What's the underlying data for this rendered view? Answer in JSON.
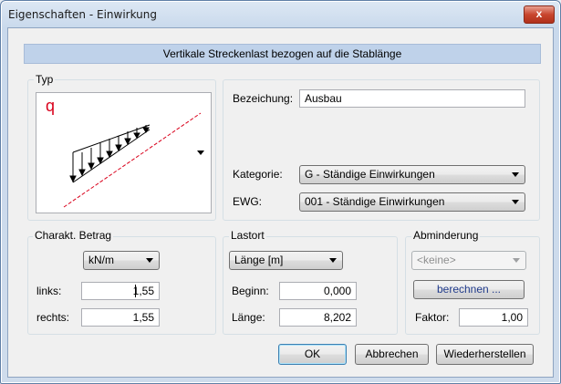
{
  "window": {
    "title": "Eigenschaften - Einwirkung",
    "close_glyph": "x"
  },
  "header": "Vertikale Streckenlast bezogen auf die Stablänge",
  "typ": {
    "label": "Typ",
    "symbol": "q",
    "symbol_color": "#d9001b"
  },
  "details": {
    "bezeichnung_label": "Bezeichung:",
    "bezeichnung_value": "Ausbau",
    "kategorie_label": "Kategorie:",
    "kategorie_value": "G - Ständige Einwirkungen",
    "ewg_label": "EWG:",
    "ewg_value": "001 - Ständige Einwirkungen"
  },
  "betrag": {
    "label": "Charakt. Betrag",
    "unit": "kN/m",
    "links_label": "links:",
    "links_value": "1,55",
    "rechts_label": "rechts:",
    "rechts_value": "1,55"
  },
  "lastort": {
    "label": "Lastort",
    "unit": "Länge [m]",
    "beginn_label": "Beginn:",
    "beginn_value": "0,000",
    "laenge_label": "Länge:",
    "laenge_value": "8,202"
  },
  "abminderung": {
    "label": "Abminderung",
    "select_value": "<keine>",
    "berechnen": "berechnen ...",
    "faktor_label": "Faktor:",
    "faktor_value": "1,00"
  },
  "buttons": {
    "ok": "OK",
    "abbrechen": "Abbrechen",
    "wiederherstellen": "Wiederherstellen"
  }
}
